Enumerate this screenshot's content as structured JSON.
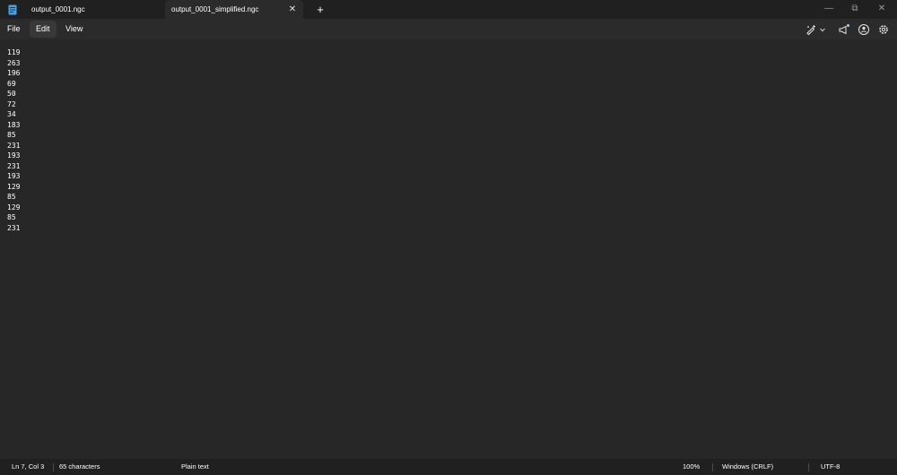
{
  "tabs": [
    {
      "label": "output_0001.ngc",
      "active": false
    },
    {
      "label": "output_0001_simplified.ngc",
      "active": true
    }
  ],
  "tab_close_glyph": "✕",
  "new_tab_glyph": "+",
  "window_controls": {
    "minimize": "—",
    "maximize": "⧉",
    "close": "✕"
  },
  "menu": {
    "file": "File",
    "edit": "Edit",
    "view": "View"
  },
  "toolbar_icons": [
    "copilot-pen-icon",
    "chevron-down-icon",
    "announcement-icon",
    "account-icon",
    "gear-icon"
  ],
  "editor": {
    "lines": [
      "119",
      "263",
      "196",
      "69",
      "50",
      "72",
      "34",
      "183",
      "85",
      "231",
      "193",
      "231",
      "193",
      "129",
      "85",
      "129",
      "85",
      "231"
    ]
  },
  "status": {
    "position": "Ln 7, Col 3",
    "characters": "65 characters",
    "format": "Plain text",
    "zoom": "100%",
    "line_ending": "Windows (CRLF)",
    "encoding": "UTF-8"
  },
  "colors": {
    "background": "#272727",
    "titlebar": "#202020",
    "active_tab": "#2b2b2b",
    "accent_dot": "#9fd3ff"
  }
}
